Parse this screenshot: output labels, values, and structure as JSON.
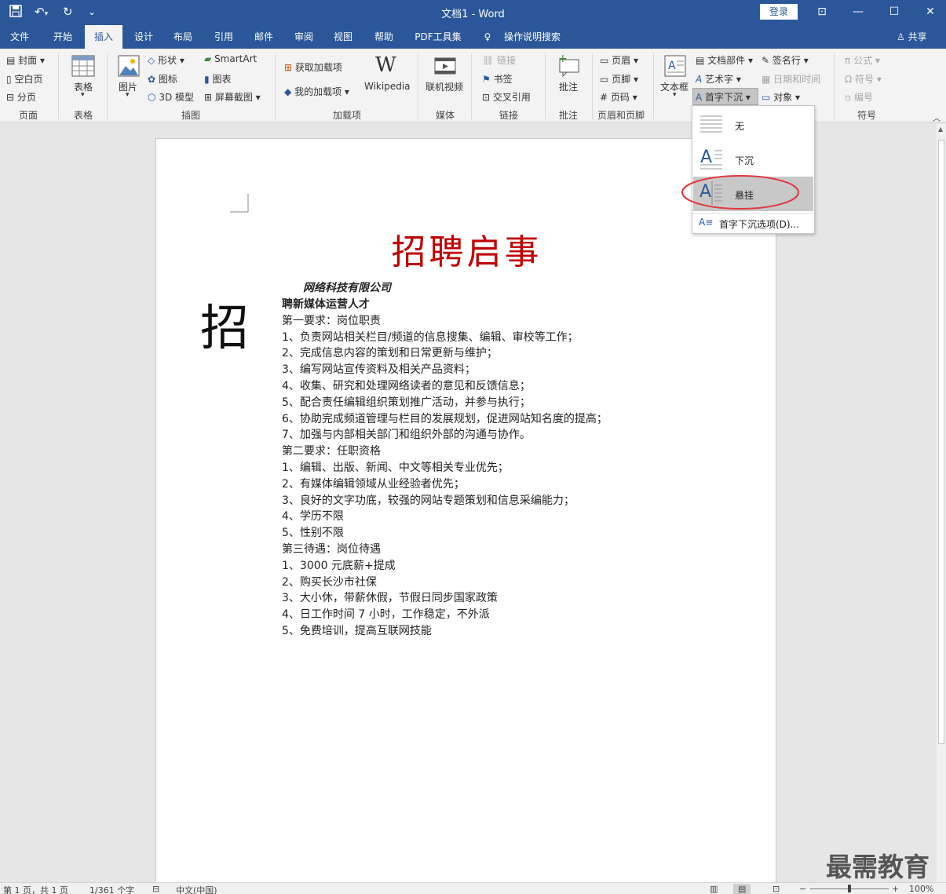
{
  "window": {
    "title": "文档1 - Word",
    "login_label": "登录",
    "share_label": "共享"
  },
  "tabs": [
    "文件",
    "开始",
    "插入",
    "设计",
    "布局",
    "引用",
    "邮件",
    "审阅",
    "视图",
    "帮助",
    "PDF工具集",
    "操作说明搜索"
  ],
  "active_tab": "插入",
  "ribbon": {
    "pages": {
      "cover": "封面",
      "blank": "空白页",
      "break": "分页",
      "group": "页面"
    },
    "tables": {
      "table": "表格",
      "group": "表格"
    },
    "illustrations": {
      "picture": "图片",
      "shapes": "形状",
      "icons": "图标",
      "model3d": "3D 模型",
      "smartart": "SmartArt",
      "chart": "图表",
      "screenshot": "屏幕截图",
      "group": "插图"
    },
    "addins": {
      "get": "获取加载项",
      "my": "我的加载项",
      "wikipedia": "Wikipedia",
      "group": "加载项"
    },
    "media": {
      "video": "联机视频",
      "group": "媒体"
    },
    "links": {
      "link": "链接",
      "bookmark": "书签",
      "crossref": "交叉引用",
      "group": "链接"
    },
    "comments": {
      "comment": "批注",
      "group": "批注"
    },
    "header_footer": {
      "header": "页眉",
      "footer": "页脚",
      "pagenum": "页码",
      "group": "页眉和页脚"
    },
    "text": {
      "textbox": "文本框",
      "docparts": "文档部件",
      "wordart": "艺术字",
      "dropcap": "首字下沉",
      "signature": "签名行",
      "datetime": "日期和时间",
      "object": "对象"
    },
    "symbols": {
      "equation": "公式",
      "symbol": "符号",
      "number": "编号",
      "group": "符号"
    }
  },
  "dropdown": {
    "items": [
      "无",
      "下沉",
      "悬挂"
    ],
    "selected": "悬挂",
    "options": "首字下沉选项(D)..."
  },
  "document": {
    "title": "招聘启事",
    "dropcap": "招",
    "company": "网络科技有限公司",
    "position": "聘新媒体运营人才",
    "lines": [
      "第一要求：岗位职责",
      "1、负责网站相关栏目/频道的信息搜集、编辑、审校等工作；",
      "2、完成信息内容的策划和日常更新与维护；",
      "3、编写网站宣传资料及相关产品资料；",
      "4、收集、研究和处理网络读者的意见和反馈信息；",
      "5、配合责任编辑组织策划推广活动，并参与执行；",
      "6、协助完成频道管理与栏目的发展规划，促进网站知名度的提高；",
      "7、加强与内部相关部门和组织外部的沟通与协作。",
      "第二要求：任职资格",
      "1、编辑、出版、新闻、中文等相关专业优先；",
      "2、有媒体编辑领域从业经验者优先；",
      "3、良好的文字功底，较强的网站专题策划和信息采编能力；",
      "4、学历不限",
      "5、性别不限",
      "第三待遇：岗位待遇",
      "1、3000 元底薪+提成",
      "2、购买长沙市社保",
      "3、大小休，带薪休假，节假日同步国家政策",
      "4、日工作时间 7 小时，工作稳定，不外派",
      "5、免费培训，提高互联网技能"
    ]
  },
  "status": {
    "page": "第 1 页，共 1 页",
    "words": "1/361 个字",
    "language": "中文(中国)",
    "zoom": "100%"
  },
  "watermark": "最需教育",
  "colors": {
    "accent": "#2b579a",
    "title_red": "#c00000",
    "highlight": "#e0383e"
  }
}
